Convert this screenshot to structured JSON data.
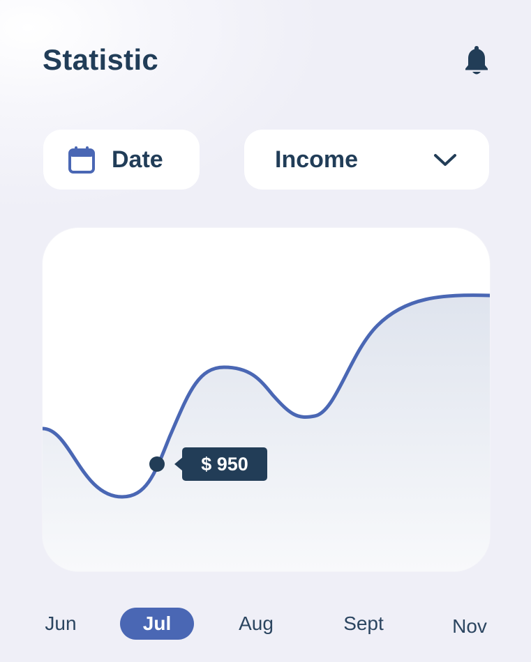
{
  "header": {
    "title": "Statistic",
    "notifications_icon": "bell-icon"
  },
  "filters": {
    "date": {
      "label": "Date",
      "icon": "calendar-icon"
    },
    "type_select": {
      "selected": "Income",
      "icon": "chevron-down-icon"
    }
  },
  "chart": {
    "tooltip": "$ 950",
    "selected_month": "Jul",
    "line_color": "#4a67b4",
    "marker_color": "#223d57"
  },
  "months": [
    {
      "label": "Jun",
      "active": false
    },
    {
      "label": "Jul",
      "active": true
    },
    {
      "label": "Aug",
      "active": false
    },
    {
      "label": "Sept",
      "active": false
    },
    {
      "label": "Nov",
      "active": false
    }
  ],
  "chart_data": {
    "type": "area",
    "categories": [
      "Jun",
      "Jul",
      "Aug",
      "Sept",
      "Nov"
    ],
    "highlighted": {
      "category": "Jul",
      "label": "$ 950"
    },
    "grid": false,
    "legend": "none"
  }
}
